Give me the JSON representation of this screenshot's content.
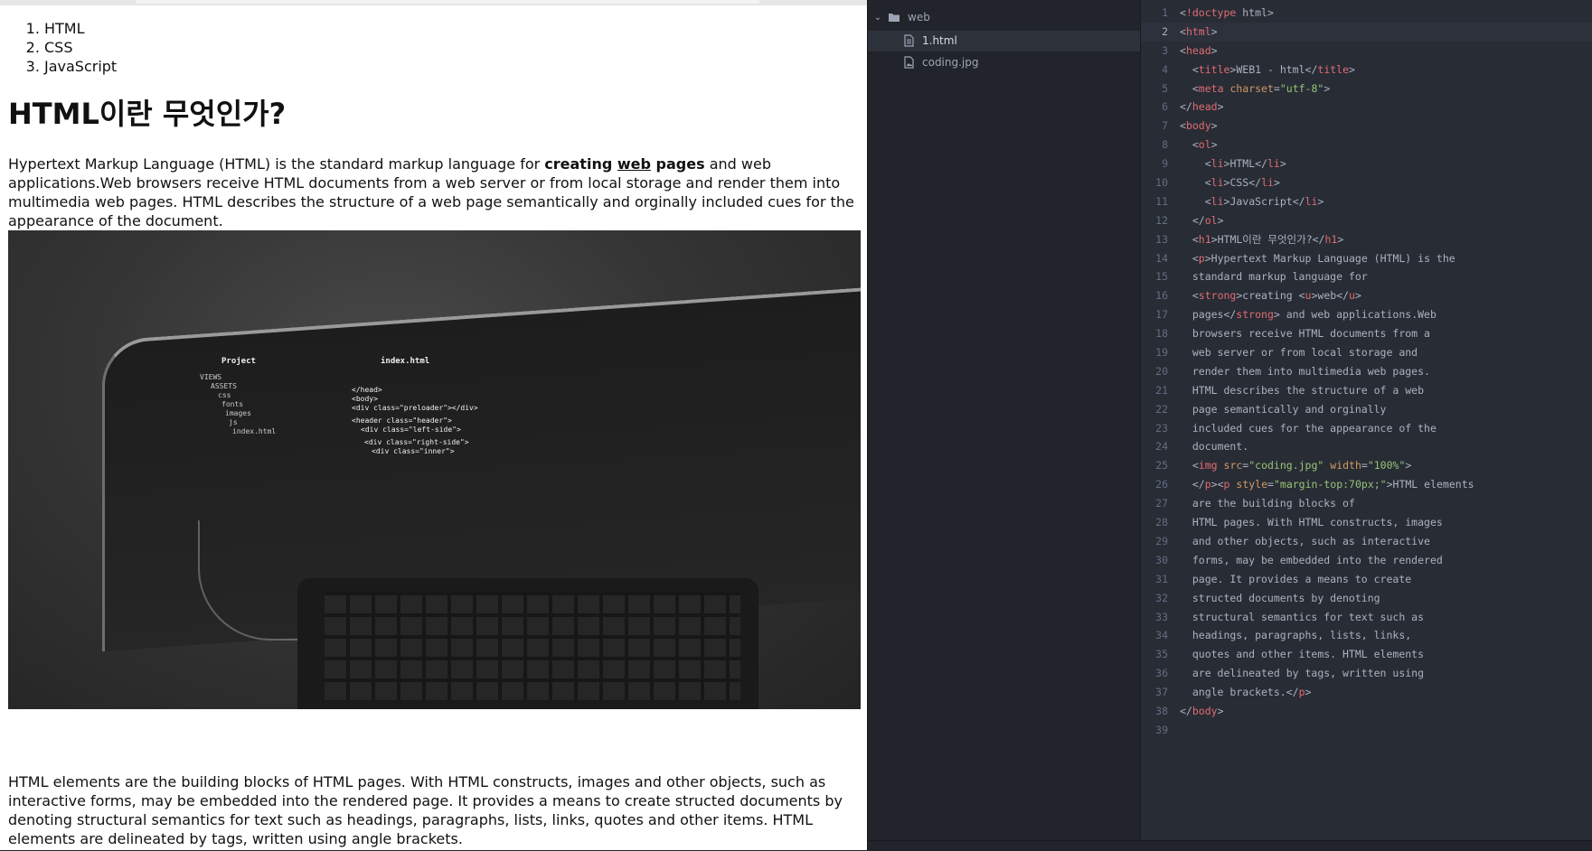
{
  "browser": {
    "list_items": [
      "HTML",
      "CSS",
      "JavaScript"
    ],
    "heading": "HTML이란 무엇인가?",
    "intro": {
      "before": "Hypertext Markup Language (HTML) is the standard markup language for ",
      "strong_start": "creating ",
      "underline": "web",
      "strong_end": " pages",
      "after": " and web applications.Web browsers receive HTML documents from a web server or from local storage and render them into multimedia web pages. HTML describes the structure of a web page semantically and orginally included cues for the appearance of the document."
    },
    "photo": {
      "panel_title": "Project",
      "tab_title": "index.html",
      "tree_lines": [
        "VIEWS",
        "ASSETS",
        "css",
        "fonts",
        "images",
        "js",
        "index.html"
      ],
      "code_lines": [
        "</head>",
        "<body>",
        "<div class=\"preloader\"></div>",
        "<header class=\"header\">",
        "<div class=\"left-side\">",
        "<div class=\"right-side\">",
        "<div class=\"inner\">"
      ]
    },
    "second_paragraph": "HTML elements are the building blocks of HTML pages. With HTML constructs, images and other objects, such as interactive forms, may be embedded into the rendered page. It provides a means to create structed documents by denoting structural semantics for text such as headings, paragraphs, lists, links, quotes and other items. HTML elements are delineated by tags, written using angle brackets."
  },
  "tree": {
    "folder": "web",
    "files": [
      {
        "name": "1.html",
        "icon": "file-text-icon",
        "selected": true
      },
      {
        "name": "coding.jpg",
        "icon": "image-file-icon",
        "selected": false
      }
    ]
  },
  "editor": {
    "active_line": 2,
    "lines": [
      "<!doctype html>",
      "<html>",
      "<head>",
      "  <title>WEB1 - html</title>",
      "  <meta charset=\"utf-8\">",
      "</head>",
      "<body>",
      "  <ol>",
      "    <li>HTML</li>",
      "    <li>CSS</li>",
      "    <li>JavaScript</li>",
      "  </ol>",
      "  <h1>HTML이란 무엇인가?</h1>",
      "  <p>Hypertext Markup Language (HTML) is the",
      "  standard markup language for",
      "  <strong>creating <u>web</u>",
      "  pages</strong> and web applications.Web",
      "  browsers receive HTML documents from a",
      "  web server or from local storage and",
      "  render them into multimedia web pages.",
      "  HTML describes the structure of a web",
      "  page semantically and orginally",
      "  included cues for the appearance of the",
      "  document.",
      "  <img src=\"coding.jpg\" width=\"100%\">",
      "  </p><p style=\"margin-top:70px;\">HTML elements",
      "  are the building blocks of",
      "  HTML pages. With HTML constructs, images",
      "  and other objects, such as interactive",
      "  forms, may be embedded into the rendered",
      "  page. It provides a means to create",
      "  structed documents by denoting",
      "  structural semantics for text such as",
      "  headings, paragraphs, lists, links,",
      "  quotes and other items. HTML elements",
      "  are delineated by tags, written using",
      "  angle brackets.</p>",
      "</body>",
      ""
    ]
  },
  "colors": {
    "tag": "#e06c75",
    "attribute": "#d19a66",
    "string": "#98c379",
    "text": "#abb2bf",
    "gutter": "#636d83",
    "editor_bg": "#282c34",
    "tree_bg": "#21252b"
  }
}
